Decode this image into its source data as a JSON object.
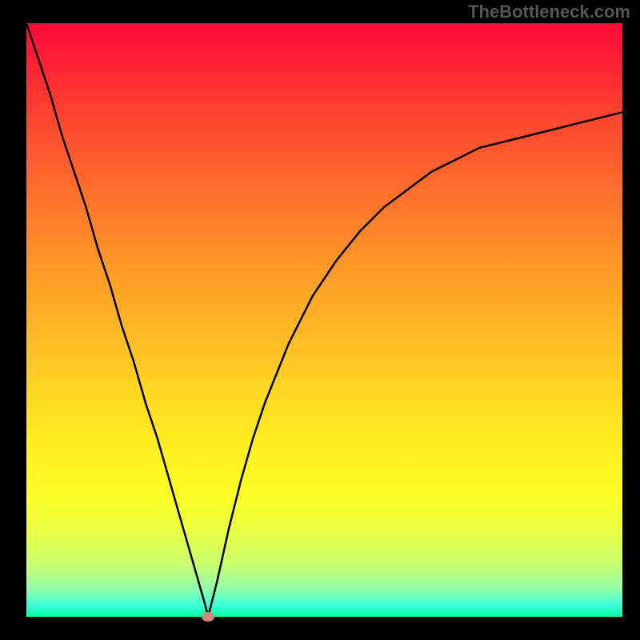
{
  "watermark": "TheBottleneck.com",
  "chart_data": {
    "type": "line",
    "title": "",
    "xlabel": "",
    "ylabel": "",
    "x": [
      0.0,
      0.02,
      0.04,
      0.06,
      0.08,
      0.1,
      0.12,
      0.14,
      0.16,
      0.18,
      0.2,
      0.22,
      0.24,
      0.26,
      0.28,
      0.3,
      0.305,
      0.31,
      0.32,
      0.34,
      0.36,
      0.38,
      0.4,
      0.44,
      0.48,
      0.52,
      0.56,
      0.6,
      0.64,
      0.68,
      0.72,
      0.76,
      0.8,
      0.84,
      0.88,
      0.92,
      0.96,
      1.0
    ],
    "values": [
      1.0,
      0.94,
      0.88,
      0.81,
      0.75,
      0.69,
      0.62,
      0.56,
      0.49,
      0.43,
      0.36,
      0.3,
      0.23,
      0.16,
      0.09,
      0.02,
      0.0,
      0.02,
      0.06,
      0.15,
      0.23,
      0.3,
      0.36,
      0.46,
      0.54,
      0.6,
      0.65,
      0.69,
      0.72,
      0.75,
      0.77,
      0.79,
      0.8,
      0.81,
      0.82,
      0.83,
      0.84,
      0.85
    ],
    "xlim": [
      0,
      1
    ],
    "ylim": [
      0,
      1
    ],
    "marker_point": {
      "x": 0.305,
      "y": 0.0
    },
    "background_gradient": [
      "#ff0a3a",
      "#ffd723",
      "#fff021",
      "#00ff9f"
    ]
  }
}
